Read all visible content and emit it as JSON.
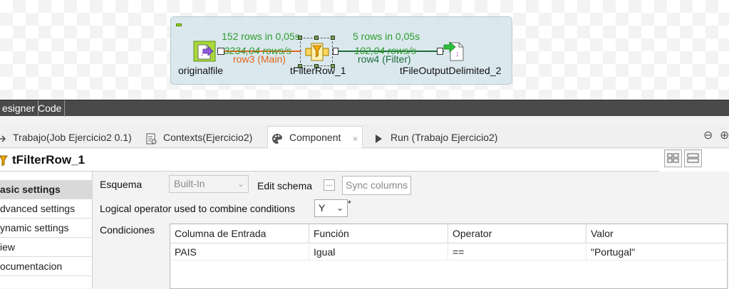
{
  "canvas": {
    "stats": [
      {
        "text": "152 rows in 0,05s"
      },
      {
        "text": "5 rows in 0,05s"
      }
    ],
    "rates": [
      {
        "text": "3234,04 rows/s"
      },
      {
        "text": "102,04 rows/s"
      }
    ],
    "connections": [
      {
        "label": "row3 (Main)",
        "color": "#e0651c"
      },
      {
        "label": "row4 (Filter)",
        "color": "#1d6d3c"
      }
    ],
    "components": [
      {
        "name": "originalfile",
        "icon": "file-input-icon"
      },
      {
        "name": "tFilterRow_1",
        "icon": "filter-icon"
      },
      {
        "name": "tFileOutputDelimited_2",
        "icon": "file-output-icon"
      }
    ]
  },
  "mode_tabs": [
    "esigner",
    "Code"
  ],
  "view_tabs": [
    {
      "label": "Trabajo(Job Ejercicio2 0.1)",
      "icon": "job-icon"
    },
    {
      "label": "Contexts(Ejercicio2)",
      "icon": "contexts-icon"
    },
    {
      "label": "Component",
      "icon": "component-palette-icon",
      "close": "×"
    },
    {
      "label": "Run (Trabajo Ejercicio2)",
      "icon": "run-icon"
    }
  ],
  "view_controls": {
    "minimize": "⊖",
    "maximize": "⊕"
  },
  "component": {
    "title": "tFilterRow_1"
  },
  "side_nav": [
    {
      "label": "asic settings",
      "active": true
    },
    {
      "label": "dvanced settings",
      "active": false
    },
    {
      "label": "ynamic settings",
      "active": false
    },
    {
      "label": "iew",
      "active": false
    },
    {
      "label": "ocumentacion",
      "active": false
    }
  ],
  "settings": {
    "esquema_label": "Esquema",
    "esquema_value": "Built-In",
    "edit_schema_label": "Edit schema",
    "edit_schema_btn": "...",
    "sync_columns": "Sync columns",
    "logical_label": "Logical operator used to combine conditions",
    "logical_value": "Y",
    "logical_required": "*",
    "conditions_label": "Condiciones"
  },
  "conditions_table": {
    "headers": [
      "Columna de Entrada",
      "Función",
      "Operator",
      "Valor"
    ],
    "rows": [
      [
        "PAIS",
        "Igual",
        "==",
        "\"Portugal\""
      ]
    ]
  },
  "colors": {
    "stat_green": "#2e9b2e",
    "mode_bar": "#4a4a4a",
    "job_box": "#d6e6ec"
  }
}
